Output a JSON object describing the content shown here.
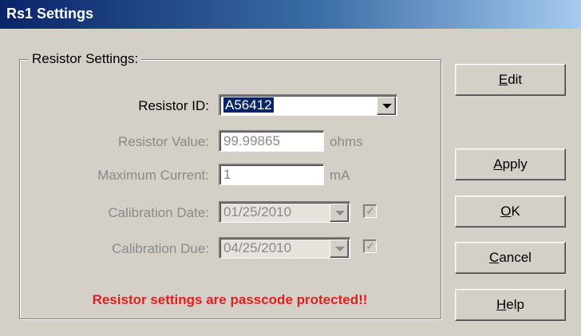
{
  "window": {
    "title": "Rs1 Settings"
  },
  "group": {
    "legend": "Resistor Settings:"
  },
  "fields": {
    "resistor_id": {
      "label": "Resistor ID:",
      "value": "A56412"
    },
    "resistor_value": {
      "label": "Resistor Value:",
      "value": "99.99865",
      "unit": "ohms"
    },
    "maximum_current": {
      "label": "Maximum Current:",
      "value": "1",
      "unit": "mA"
    },
    "calibration_date": {
      "label": "Calibration Date:",
      "value": "01/25/2010",
      "checked": true
    },
    "calibration_due": {
      "label": "Calibration Due:",
      "value": "04/25/2010",
      "checked": true
    }
  },
  "warning": "Resistor settings are passcode protected!!",
  "buttons": {
    "edit": {
      "mnemonic": "E",
      "rest": "dit"
    },
    "apply": {
      "mnemonic": "A",
      "rest": "pply"
    },
    "ok": {
      "mnemonic": "O",
      "rest": "K"
    },
    "cancel": {
      "mnemonic": "C",
      "rest": "ancel"
    },
    "help": {
      "mnemonic": "H",
      "rest": "elp"
    }
  },
  "colors": {
    "accent": "#0a246a",
    "warning": "#e02020",
    "face": "#d4d0c8"
  }
}
